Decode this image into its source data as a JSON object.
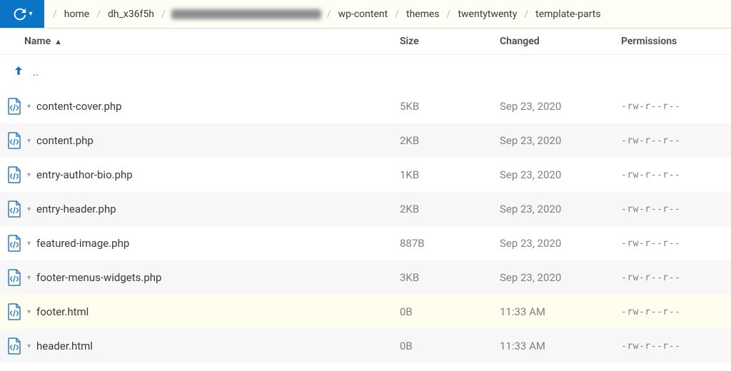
{
  "toolbar": {
    "history_icon": "history"
  },
  "breadcrumbs": [
    {
      "label": "home",
      "redacted": false
    },
    {
      "label": "dh_x36f5h",
      "redacted": false
    },
    {
      "label": "",
      "redacted": true
    },
    {
      "label": "wp-content",
      "redacted": false
    },
    {
      "label": "themes",
      "redacted": false
    },
    {
      "label": "twentytwenty",
      "redacted": false
    },
    {
      "label": "template-parts",
      "redacted": false
    }
  ],
  "columns": {
    "name": "Name",
    "size": "Size",
    "changed": "Changed",
    "permissions": "Permissions",
    "sort_indicator": "▲"
  },
  "parent_label": "..",
  "files": [
    {
      "name": "content-cover.php",
      "size": "5KB",
      "changed": "Sep 23, 2020",
      "perm": "-rw-r--r--",
      "highlight": false
    },
    {
      "name": "content.php",
      "size": "2KB",
      "changed": "Sep 23, 2020",
      "perm": "-rw-r--r--",
      "highlight": false
    },
    {
      "name": "entry-author-bio.php",
      "size": "1KB",
      "changed": "Sep 23, 2020",
      "perm": "-rw-r--r--",
      "highlight": false
    },
    {
      "name": "entry-header.php",
      "size": "2KB",
      "changed": "Sep 23, 2020",
      "perm": "-rw-r--r--",
      "highlight": false
    },
    {
      "name": "featured-image.php",
      "size": "887B",
      "changed": "Sep 23, 2020",
      "perm": "-rw-r--r--",
      "highlight": false
    },
    {
      "name": "footer-menus-widgets.php",
      "size": "3KB",
      "changed": "Sep 23, 2020",
      "perm": "-rw-r--r--",
      "highlight": false
    },
    {
      "name": "footer.html",
      "size": "0B",
      "changed": "11:33 AM",
      "perm": "-rw-r--r--",
      "highlight": true
    },
    {
      "name": "header.html",
      "size": "0B",
      "changed": "11:33 AM",
      "perm": "-rw-r--r--",
      "highlight": false
    }
  ]
}
